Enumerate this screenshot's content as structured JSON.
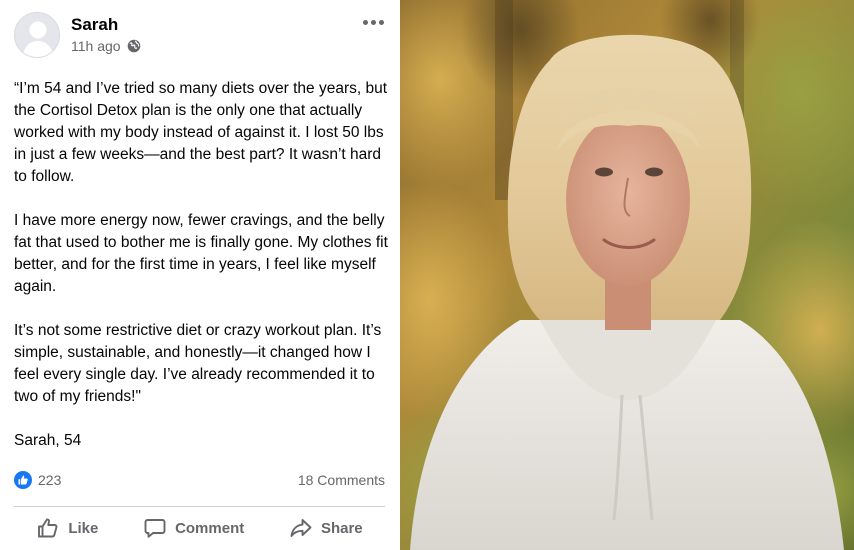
{
  "post": {
    "author": "Sarah",
    "time": "11h ago",
    "paragraphs": [
      "“I’m 54 and I’ve tried so many diets over the years, but the Cortisol Detox plan is the only one that actually worked with my body instead of against it. I lost 50 lbs in just a few weeks—and the best part? It wasn’t hard to follow.",
      "I have more energy now, fewer cravings, and the belly fat that used to bother me is finally gone. My clothes fit better, and for the first time in years, I feel like myself again.",
      "It’s not some restrictive diet or crazy workout plan. It’s simple, sustainable, and honestly—it changed how I feel every single day. I’ve already recommended it to two of my friends!\"",
      "Sarah, 54"
    ],
    "reactions_count": "223",
    "comments_count": "18 Comments"
  },
  "actions": {
    "like_label": "Like",
    "comment_label": "Comment",
    "share_label": "Share"
  },
  "icons": {
    "avatar": "default-avatar-icon",
    "privacy": "globe-icon",
    "more": "more-options-icon",
    "reaction": "like-reaction-icon",
    "like": "thumbs-up-icon",
    "comment": "comment-bubble-icon",
    "share": "share-arrow-icon"
  },
  "colors": {
    "accent": "#1877f2",
    "secondary_text": "#65676b",
    "divider": "#ced0d4"
  }
}
